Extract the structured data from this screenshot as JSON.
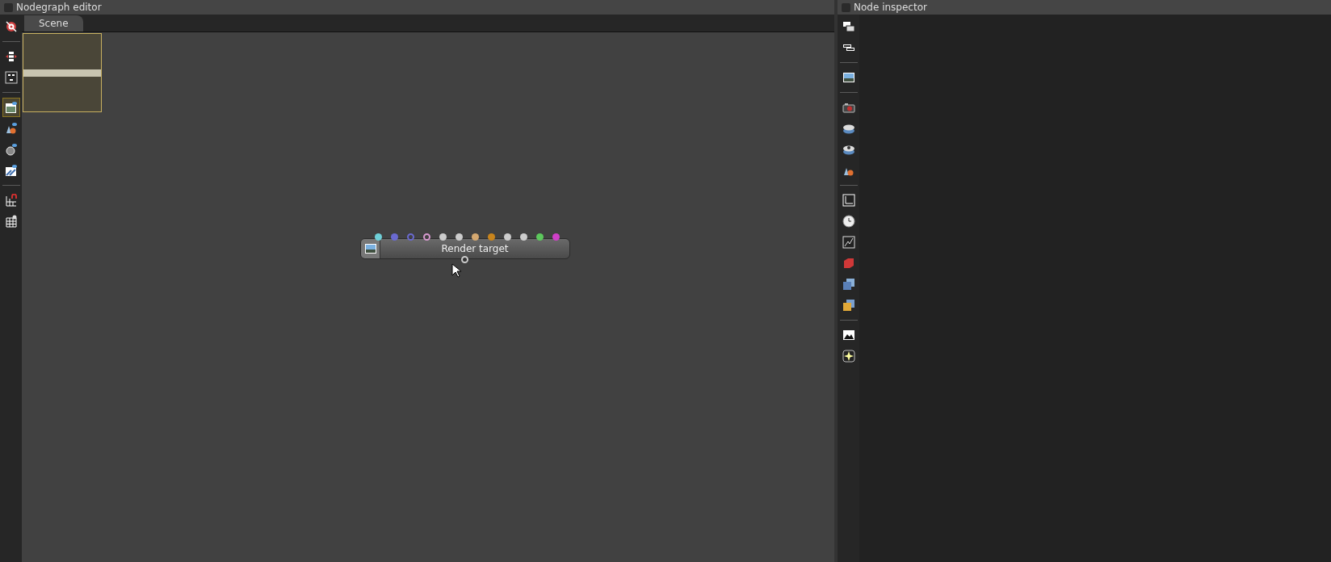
{
  "nodegraph_editor": {
    "title": "Nodegraph editor",
    "checked": false,
    "toolbar": [
      {
        "kind": "button",
        "selected": false
      },
      {
        "kind": "separator"
      },
      {
        "kind": "button",
        "selected": false
      },
      {
        "kind": "button",
        "selected": false
      },
      {
        "kind": "separator"
      },
      {
        "kind": "button",
        "selected": true
      },
      {
        "kind": "button",
        "selected": false
      },
      {
        "kind": "button",
        "selected": false
      },
      {
        "kind": "button",
        "selected": false
      },
      {
        "kind": "separator"
      },
      {
        "kind": "button",
        "selected": false
      },
      {
        "kind": "button",
        "selected": false
      }
    ],
    "tabs": [
      {
        "label": "Scene",
        "selected": true
      }
    ],
    "node": {
      "label": "Render target",
      "inputs": [
        {
          "color": "#6fd0d8",
          "kind": "filled"
        },
        {
          "color": "#6a6ad0",
          "kind": "filled"
        },
        {
          "color": "#6a6ad0",
          "kind": "hollow"
        },
        {
          "color": "#d89ad0",
          "kind": "hollow"
        },
        {
          "color": "#cccccc",
          "kind": "filled"
        },
        {
          "color": "#cccccc",
          "kind": "filled"
        },
        {
          "color": "#d4a870",
          "kind": "filled"
        },
        {
          "color": "#c8841c",
          "kind": "filled"
        },
        {
          "color": "#cccccc",
          "kind": "filled"
        },
        {
          "color": "#cccccc",
          "kind": "filled"
        },
        {
          "color": "#5cc85c",
          "kind": "filled"
        },
        {
          "color": "#d040c8",
          "kind": "filled"
        }
      ]
    }
  },
  "node_inspector": {
    "title": "Node inspector",
    "checked": false,
    "toolbar": [
      {
        "kind": "button"
      },
      {
        "kind": "button"
      },
      {
        "kind": "separator"
      },
      {
        "kind": "button"
      },
      {
        "kind": "separator"
      },
      {
        "kind": "button"
      },
      {
        "kind": "button"
      },
      {
        "kind": "button"
      },
      {
        "kind": "button"
      },
      {
        "kind": "separator"
      },
      {
        "kind": "button"
      },
      {
        "kind": "button"
      },
      {
        "kind": "button"
      },
      {
        "kind": "button"
      },
      {
        "kind": "button"
      },
      {
        "kind": "button"
      },
      {
        "kind": "separator"
      },
      {
        "kind": "button"
      },
      {
        "kind": "button"
      }
    ]
  }
}
